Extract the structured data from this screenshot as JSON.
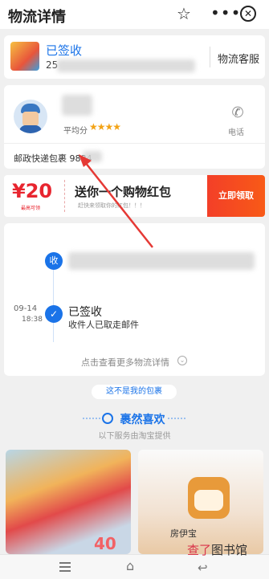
{
  "header": {
    "title": "物流详情",
    "close_glyph": "✕",
    "star_glyph": "☆",
    "more_glyph": "•••"
  },
  "status": {
    "label": "已签收",
    "number_prefix": "25",
    "service_label": "物流客服"
  },
  "courier": {
    "rating_label": "平均分",
    "stars": "★★★★",
    "phone_label": "电话",
    "tracking_prefix": "邮政快递包裹 9884"
  },
  "promo": {
    "amount": "¥20",
    "coupon_caption": "最高可领",
    "title": "送你一个购物红包",
    "subtitle": "赶快来领取你的红包！！！",
    "button": "立即领取"
  },
  "timeline": {
    "collect_badge": "收",
    "signed_date": "09-14",
    "signed_time": "18:38",
    "signed_status": "已签收",
    "signed_desc": "收件人已取走邮件",
    "more_label": "点击查看更多物流详情"
  },
  "actions": {
    "not_mine": "这不是我的包裹"
  },
  "recommend": {
    "title": "裹然喜欢",
    "subtitle": "以下服务由淘宝提供",
    "product_1_price": "40张",
    "product_2_tag": "房伊宝"
  },
  "watermark": {
    "accent": "查了",
    "rest": "图书馆"
  },
  "colors": {
    "accent_blue": "#1a73e8",
    "promo_red": "#f33f28",
    "star_gold": "#f3a316"
  }
}
